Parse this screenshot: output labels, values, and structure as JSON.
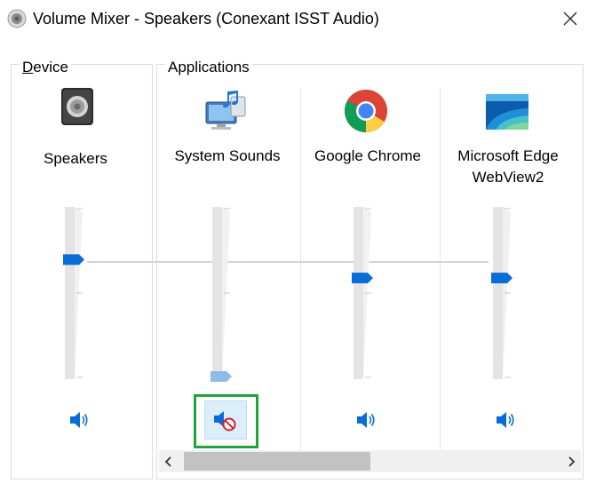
{
  "window": {
    "title": "Volume Mixer - Speakers (Conexant ISST Audio)",
    "app_icon": "speaker-icon",
    "close_icon": "close-icon"
  },
  "device": {
    "group_label_underlined": "D",
    "group_label_rest": "evice",
    "channel": {
      "name": "Speakers",
      "icon": "speaker-device-icon",
      "volume_percent": 70,
      "muted": false,
      "mute_icon": "speaker-on-icon"
    }
  },
  "applications": {
    "group_label": "Applications",
    "channels": [
      {
        "name": "System Sounds",
        "name_line2": "",
        "icon": "system-sounds-icon",
        "volume_percent": 0,
        "muted": true,
        "mute_icon": "speaker-muted-icon"
      },
      {
        "name": "Google Chrome",
        "name_line2": "",
        "icon": "chrome-icon",
        "volume_percent": 59,
        "muted": false,
        "mute_icon": "speaker-on-icon"
      },
      {
        "name": "Microsoft Edge",
        "name_line2": "WebView2",
        "icon": "edge-webview-icon",
        "volume_percent": 59,
        "muted": false,
        "mute_icon": "speaker-on-icon"
      }
    ]
  },
  "scrollbar": {
    "left_icon": "chevron-left-icon",
    "right_icon": "chevron-right-icon",
    "position_fraction": 0.0
  },
  "colors": {
    "accent": "#0a6cd6",
    "accent_disabled": "#8ebbe8",
    "highlight": "#21a33a",
    "track": "#dadada"
  }
}
